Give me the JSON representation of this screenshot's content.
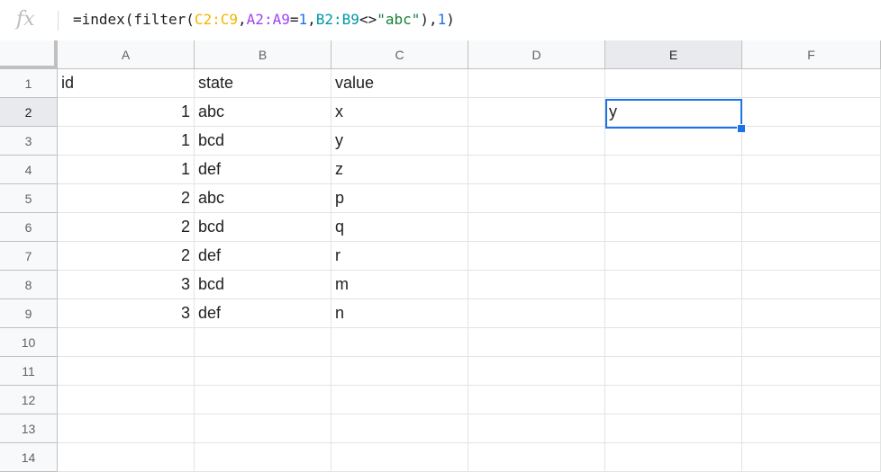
{
  "formula_bar": {
    "icon": "fx-icon",
    "parts": {
      "p1": "=index(filter(",
      "r1": "C2:C9",
      "c1": ",",
      "r2": "A2:A9",
      "eq": "=",
      "n1": "1",
      "c2": ",",
      "r3": "B2:B9",
      "op": "<>",
      "s1": "\"abc\"",
      "p2": "),",
      "n2": "1",
      "p3": ")"
    }
  },
  "columns": [
    "A",
    "B",
    "C",
    "D",
    "E",
    "F"
  ],
  "rows": [
    "1",
    "2",
    "3",
    "4",
    "5",
    "6",
    "7",
    "8",
    "9",
    "10",
    "11",
    "12",
    "13",
    "14"
  ],
  "cells": {
    "r1": {
      "a": "id",
      "b": "state",
      "c": "value"
    },
    "r2": {
      "a": "1",
      "b": "abc",
      "c": "x",
      "e": "y"
    },
    "r3": {
      "a": "1",
      "b": "bcd",
      "c": "y"
    },
    "r4": {
      "a": "1",
      "b": "def",
      "c": "z"
    },
    "r5": {
      "a": "2",
      "b": "abc",
      "c": "p"
    },
    "r6": {
      "a": "2",
      "b": "bcd",
      "c": "q"
    },
    "r7": {
      "a": "2",
      "b": "def",
      "c": "r"
    },
    "r8": {
      "a": "3",
      "b": "bcd",
      "c": "m"
    },
    "r9": {
      "a": "3",
      "b": "def",
      "c": "n"
    }
  },
  "selection": {
    "column": "E",
    "row": "2"
  },
  "colors": {
    "selection": "#1a73e8",
    "range_c": "#f4b400",
    "range_a": "#a142f4",
    "range_b": "#0097a7",
    "string": "#188038"
  }
}
